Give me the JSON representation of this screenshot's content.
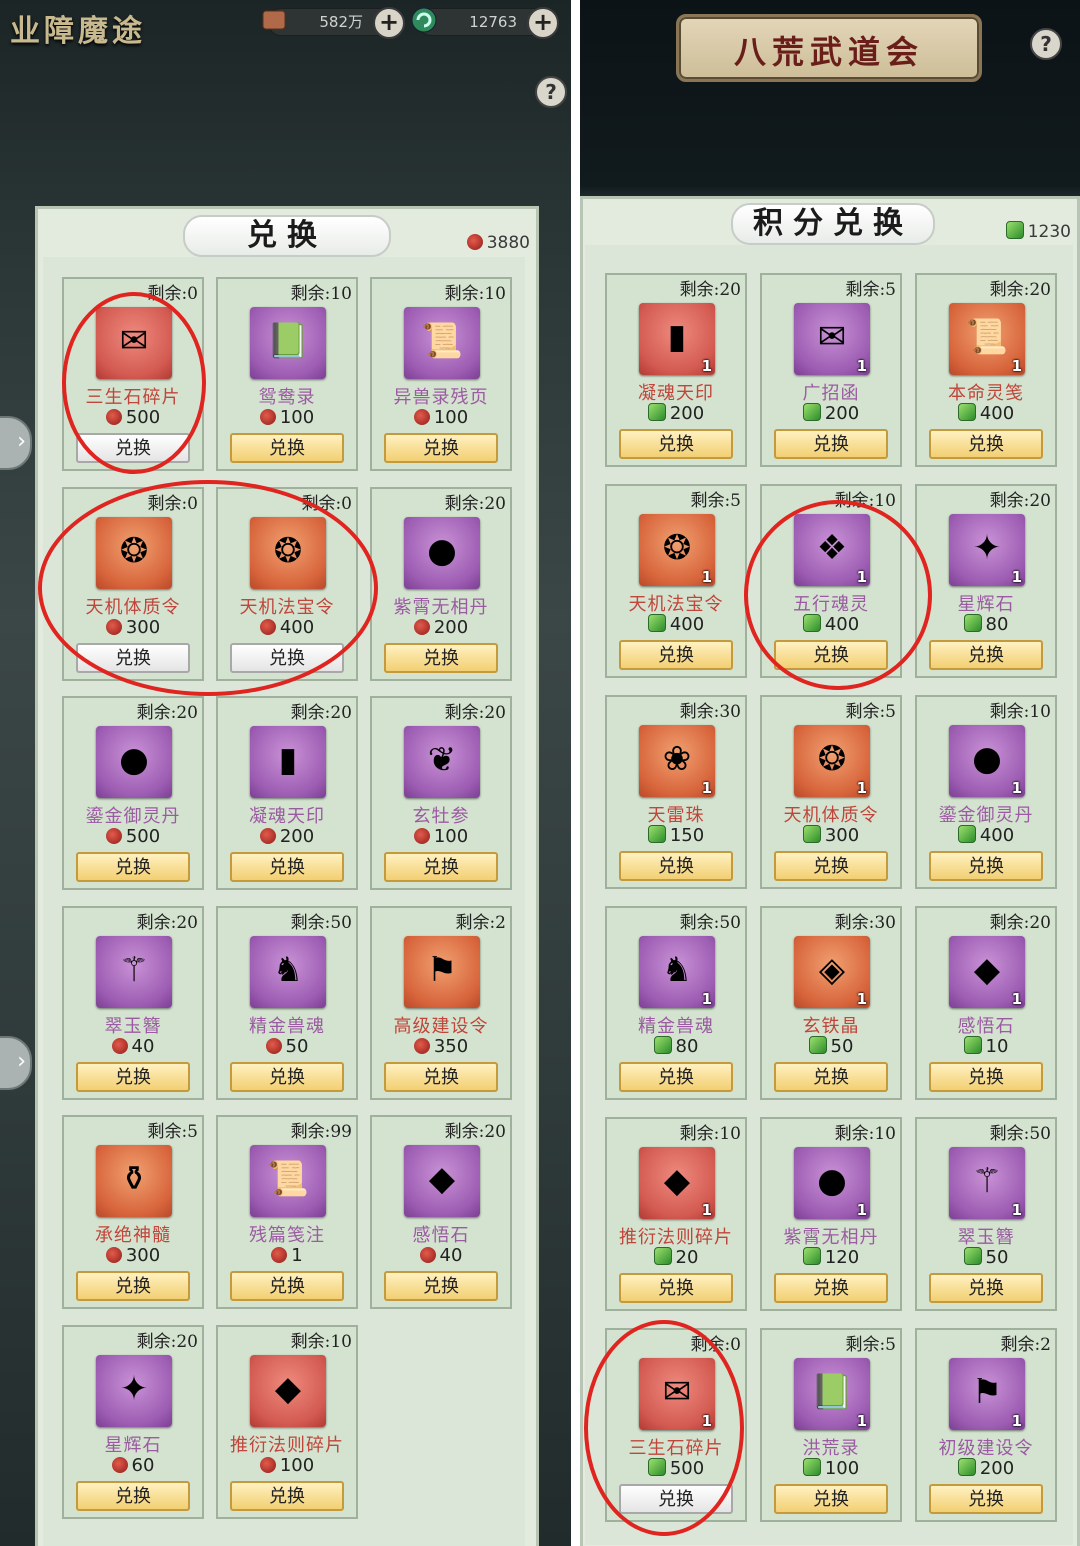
{
  "left": {
    "title": "业障魔途",
    "resource1": "582万",
    "resource2": "12763",
    "help": "?",
    "frame_title": "兑换",
    "balance": "3880",
    "items": [
      {
        "remain": "剩余:0",
        "name": "三生石碎片",
        "price": "500",
        "btn": "兑换",
        "disabled": true,
        "color": "red",
        "glyph": "✉"
      },
      {
        "remain": "剩余:10",
        "name": "鸳鸯录",
        "price": "100",
        "btn": "兑换",
        "disabled": false,
        "color": "purple",
        "glyph": "📗"
      },
      {
        "remain": "剩余:10",
        "name": "异兽录残页",
        "price": "100",
        "btn": "兑换",
        "disabled": false,
        "color": "purple",
        "glyph": "📜"
      },
      {
        "remain": "剩余:0",
        "name": "天机体质令",
        "price": "300",
        "btn": "兑换",
        "disabled": true,
        "color": "orange",
        "glyph": "❂"
      },
      {
        "remain": "剩余:0",
        "name": "天机法宝令",
        "price": "400",
        "btn": "兑换",
        "disabled": true,
        "color": "orange",
        "glyph": "❂"
      },
      {
        "remain": "剩余:20",
        "name": "紫霄无相丹",
        "price": "200",
        "btn": "兑换",
        "disabled": false,
        "color": "purple",
        "glyph": "●"
      },
      {
        "remain": "剩余:20",
        "name": "鎏金御灵丹",
        "price": "500",
        "btn": "兑换",
        "disabled": false,
        "color": "purple",
        "glyph": "●"
      },
      {
        "remain": "剩余:20",
        "name": "凝魂天印",
        "price": "200",
        "btn": "兑换",
        "disabled": false,
        "color": "purple",
        "glyph": "▮"
      },
      {
        "remain": "剩余:20",
        "name": "玄牡参",
        "price": "100",
        "btn": "兑换",
        "disabled": false,
        "color": "purple",
        "glyph": "❦"
      },
      {
        "remain": "剩余:20",
        "name": "翠玉簪",
        "price": "40",
        "btn": "兑换",
        "disabled": false,
        "color": "purple",
        "glyph": "⚚"
      },
      {
        "remain": "剩余:50",
        "name": "精金兽魂",
        "price": "50",
        "btn": "兑换",
        "disabled": false,
        "color": "purple",
        "glyph": "♞"
      },
      {
        "remain": "剩余:2",
        "name": "高级建设令",
        "price": "350",
        "btn": "兑换",
        "disabled": false,
        "color": "orange",
        "glyph": "⚑"
      },
      {
        "remain": "剩余:5",
        "name": "承绝神髓",
        "price": "300",
        "btn": "兑换",
        "disabled": false,
        "color": "orange",
        "glyph": "⚱"
      },
      {
        "remain": "剩余:99",
        "name": "残篇笺注",
        "price": "1",
        "btn": "兑换",
        "disabled": false,
        "color": "purple",
        "glyph": "📜"
      },
      {
        "remain": "剩余:20",
        "name": "感悟石",
        "price": "40",
        "btn": "兑换",
        "disabled": false,
        "color": "purple",
        "glyph": "◆"
      },
      {
        "remain": "剩余:20",
        "name": "星辉石",
        "price": "60",
        "btn": "兑换",
        "disabled": false,
        "color": "purple",
        "glyph": "✦"
      },
      {
        "remain": "剩余:10",
        "name": "推衍法则碎片",
        "price": "100",
        "btn": "兑换",
        "disabled": false,
        "color": "red",
        "glyph": "◆"
      }
    ]
  },
  "right": {
    "title": "八荒武道会",
    "help": "?",
    "frame_title": "积分兑换",
    "balance": "1230",
    "items": [
      {
        "remain": "剩余:20",
        "name": "凝魂天印",
        "price": "200",
        "qty": "1",
        "btn": "兑换",
        "disabled": false,
        "color": "red",
        "glyph": "▮"
      },
      {
        "remain": "剩余:5",
        "name": "广招函",
        "price": "200",
        "qty": "1",
        "btn": "兑换",
        "disabled": false,
        "color": "purple",
        "glyph": "✉"
      },
      {
        "remain": "剩余:20",
        "name": "本命灵笺",
        "price": "400",
        "qty": "1",
        "btn": "兑换",
        "disabled": false,
        "color": "orange",
        "glyph": "📜"
      },
      {
        "remain": "剩余:5",
        "name": "天机法宝令",
        "price": "400",
        "qty": "1",
        "btn": "兑换",
        "disabled": false,
        "color": "orange",
        "glyph": "❂"
      },
      {
        "remain": "剩余:10",
        "name": "五行魂灵",
        "price": "400",
        "qty": "1",
        "btn": "兑换",
        "disabled": false,
        "color": "purple",
        "glyph": "❖"
      },
      {
        "remain": "剩余:20",
        "name": "星辉石",
        "price": "80",
        "qty": "1",
        "btn": "兑换",
        "disabled": false,
        "color": "purple",
        "glyph": "✦"
      },
      {
        "remain": "剩余:30",
        "name": "天雷珠",
        "price": "150",
        "qty": "1",
        "btn": "兑换",
        "disabled": false,
        "color": "orange",
        "glyph": "❀"
      },
      {
        "remain": "剩余:5",
        "name": "天机体质令",
        "price": "300",
        "qty": "1",
        "btn": "兑换",
        "disabled": false,
        "color": "orange",
        "glyph": "❂"
      },
      {
        "remain": "剩余:10",
        "name": "鎏金御灵丹",
        "price": "400",
        "qty": "1",
        "btn": "兑换",
        "disabled": false,
        "color": "purple",
        "glyph": "●"
      },
      {
        "remain": "剩余:50",
        "name": "精金兽魂",
        "price": "80",
        "qty": "1",
        "btn": "兑换",
        "disabled": false,
        "color": "purple",
        "glyph": "♞"
      },
      {
        "remain": "剩余:30",
        "name": "玄铁晶",
        "price": "50",
        "qty": "1",
        "btn": "兑换",
        "disabled": false,
        "color": "orange",
        "glyph": "◈"
      },
      {
        "remain": "剩余:20",
        "name": "感悟石",
        "price": "10",
        "qty": "1",
        "btn": "兑换",
        "disabled": false,
        "color": "purple",
        "glyph": "◆"
      },
      {
        "remain": "剩余:10",
        "name": "推衍法则碎片",
        "price": "20",
        "qty": "1",
        "btn": "兑换",
        "disabled": false,
        "color": "red",
        "glyph": "◆"
      },
      {
        "remain": "剩余:10",
        "name": "紫霄无相丹",
        "price": "120",
        "qty": "1",
        "btn": "兑换",
        "disabled": false,
        "color": "purple",
        "glyph": "●"
      },
      {
        "remain": "剩余:50",
        "name": "翠玉簪",
        "price": "50",
        "qty": "1",
        "btn": "兑换",
        "disabled": false,
        "color": "purple",
        "glyph": "⚚"
      },
      {
        "remain": "剩余:0",
        "name": "三生石碎片",
        "price": "500",
        "qty": "1",
        "btn": "兑换",
        "disabled": true,
        "color": "red",
        "glyph": "✉"
      },
      {
        "remain": "剩余:5",
        "name": "洪荒录",
        "price": "100",
        "qty": "1",
        "btn": "兑换",
        "disabled": false,
        "color": "purple",
        "glyph": "📗"
      },
      {
        "remain": "剩余:2",
        "name": "初级建设令",
        "price": "200",
        "qty": "1",
        "btn": "兑换",
        "disabled": false,
        "color": "purple",
        "glyph": "⚑"
      }
    ]
  }
}
